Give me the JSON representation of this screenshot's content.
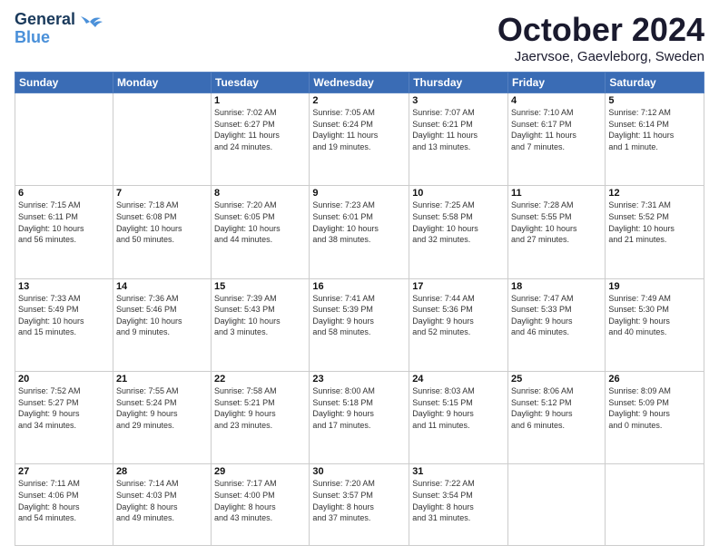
{
  "header": {
    "logo_line1": "General",
    "logo_line2": "Blue",
    "month": "October 2024",
    "location": "Jaervsoe, Gaevleborg, Sweden"
  },
  "days_of_week": [
    "Sunday",
    "Monday",
    "Tuesday",
    "Wednesday",
    "Thursday",
    "Friday",
    "Saturday"
  ],
  "weeks": [
    [
      {
        "day": "",
        "info": ""
      },
      {
        "day": "",
        "info": ""
      },
      {
        "day": "1",
        "info": "Sunrise: 7:02 AM\nSunset: 6:27 PM\nDaylight: 11 hours\nand 24 minutes."
      },
      {
        "day": "2",
        "info": "Sunrise: 7:05 AM\nSunset: 6:24 PM\nDaylight: 11 hours\nand 19 minutes."
      },
      {
        "day": "3",
        "info": "Sunrise: 7:07 AM\nSunset: 6:21 PM\nDaylight: 11 hours\nand 13 minutes."
      },
      {
        "day": "4",
        "info": "Sunrise: 7:10 AM\nSunset: 6:17 PM\nDaylight: 11 hours\nand 7 minutes."
      },
      {
        "day": "5",
        "info": "Sunrise: 7:12 AM\nSunset: 6:14 PM\nDaylight: 11 hours\nand 1 minute."
      }
    ],
    [
      {
        "day": "6",
        "info": "Sunrise: 7:15 AM\nSunset: 6:11 PM\nDaylight: 10 hours\nand 56 minutes."
      },
      {
        "day": "7",
        "info": "Sunrise: 7:18 AM\nSunset: 6:08 PM\nDaylight: 10 hours\nand 50 minutes."
      },
      {
        "day": "8",
        "info": "Sunrise: 7:20 AM\nSunset: 6:05 PM\nDaylight: 10 hours\nand 44 minutes."
      },
      {
        "day": "9",
        "info": "Sunrise: 7:23 AM\nSunset: 6:01 PM\nDaylight: 10 hours\nand 38 minutes."
      },
      {
        "day": "10",
        "info": "Sunrise: 7:25 AM\nSunset: 5:58 PM\nDaylight: 10 hours\nand 32 minutes."
      },
      {
        "day": "11",
        "info": "Sunrise: 7:28 AM\nSunset: 5:55 PM\nDaylight: 10 hours\nand 27 minutes."
      },
      {
        "day": "12",
        "info": "Sunrise: 7:31 AM\nSunset: 5:52 PM\nDaylight: 10 hours\nand 21 minutes."
      }
    ],
    [
      {
        "day": "13",
        "info": "Sunrise: 7:33 AM\nSunset: 5:49 PM\nDaylight: 10 hours\nand 15 minutes."
      },
      {
        "day": "14",
        "info": "Sunrise: 7:36 AM\nSunset: 5:46 PM\nDaylight: 10 hours\nand 9 minutes."
      },
      {
        "day": "15",
        "info": "Sunrise: 7:39 AM\nSunset: 5:43 PM\nDaylight: 10 hours\nand 3 minutes."
      },
      {
        "day": "16",
        "info": "Sunrise: 7:41 AM\nSunset: 5:39 PM\nDaylight: 9 hours\nand 58 minutes."
      },
      {
        "day": "17",
        "info": "Sunrise: 7:44 AM\nSunset: 5:36 PM\nDaylight: 9 hours\nand 52 minutes."
      },
      {
        "day": "18",
        "info": "Sunrise: 7:47 AM\nSunset: 5:33 PM\nDaylight: 9 hours\nand 46 minutes."
      },
      {
        "day": "19",
        "info": "Sunrise: 7:49 AM\nSunset: 5:30 PM\nDaylight: 9 hours\nand 40 minutes."
      }
    ],
    [
      {
        "day": "20",
        "info": "Sunrise: 7:52 AM\nSunset: 5:27 PM\nDaylight: 9 hours\nand 34 minutes."
      },
      {
        "day": "21",
        "info": "Sunrise: 7:55 AM\nSunset: 5:24 PM\nDaylight: 9 hours\nand 29 minutes."
      },
      {
        "day": "22",
        "info": "Sunrise: 7:58 AM\nSunset: 5:21 PM\nDaylight: 9 hours\nand 23 minutes."
      },
      {
        "day": "23",
        "info": "Sunrise: 8:00 AM\nSunset: 5:18 PM\nDaylight: 9 hours\nand 17 minutes."
      },
      {
        "day": "24",
        "info": "Sunrise: 8:03 AM\nSunset: 5:15 PM\nDaylight: 9 hours\nand 11 minutes."
      },
      {
        "day": "25",
        "info": "Sunrise: 8:06 AM\nSunset: 5:12 PM\nDaylight: 9 hours\nand 6 minutes."
      },
      {
        "day": "26",
        "info": "Sunrise: 8:09 AM\nSunset: 5:09 PM\nDaylight: 9 hours\nand 0 minutes."
      }
    ],
    [
      {
        "day": "27",
        "info": "Sunrise: 7:11 AM\nSunset: 4:06 PM\nDaylight: 8 hours\nand 54 minutes."
      },
      {
        "day": "28",
        "info": "Sunrise: 7:14 AM\nSunset: 4:03 PM\nDaylight: 8 hours\nand 49 minutes."
      },
      {
        "day": "29",
        "info": "Sunrise: 7:17 AM\nSunset: 4:00 PM\nDaylight: 8 hours\nand 43 minutes."
      },
      {
        "day": "30",
        "info": "Sunrise: 7:20 AM\nSunset: 3:57 PM\nDaylight: 8 hours\nand 37 minutes."
      },
      {
        "day": "31",
        "info": "Sunrise: 7:22 AM\nSunset: 3:54 PM\nDaylight: 8 hours\nand 31 minutes."
      },
      {
        "day": "",
        "info": ""
      },
      {
        "day": "",
        "info": ""
      }
    ]
  ]
}
